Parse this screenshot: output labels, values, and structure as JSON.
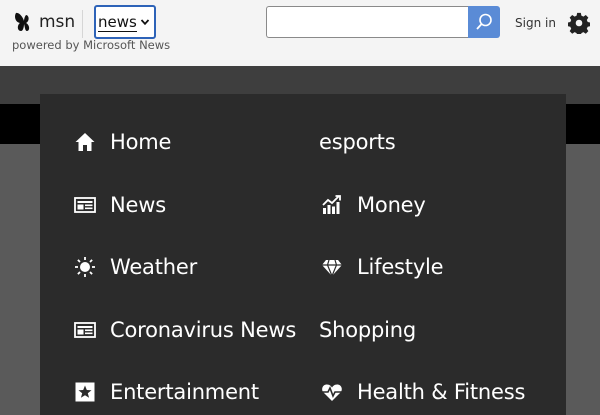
{
  "header": {
    "logo_text": "msn",
    "vertical_select_value": "news",
    "powered_by": "powered by Microsoft News",
    "search_placeholder": "",
    "sign_in_label": "Sign in"
  },
  "menu": {
    "left": [
      {
        "label": "Home",
        "icon": "home-icon"
      },
      {
        "label": "News",
        "icon": "news-icon"
      },
      {
        "label": "Weather",
        "icon": "sun-icon"
      },
      {
        "label": "Coronavirus News",
        "icon": "news-icon"
      },
      {
        "label": "Entertainment",
        "icon": "star-icon"
      }
    ],
    "right": [
      {
        "label": "esports",
        "icon": ""
      },
      {
        "label": "Money",
        "icon": "chart-icon"
      },
      {
        "label": "Lifestyle",
        "icon": "diamond-icon"
      },
      {
        "label": "Shopping",
        "icon": ""
      },
      {
        "label": "Health & Fitness",
        "icon": "heart-pulse-icon"
      }
    ]
  },
  "colors": {
    "accent": "#2e63b8",
    "search_button": "#5a8bd6",
    "menu_bg": "#2b2b2b"
  }
}
